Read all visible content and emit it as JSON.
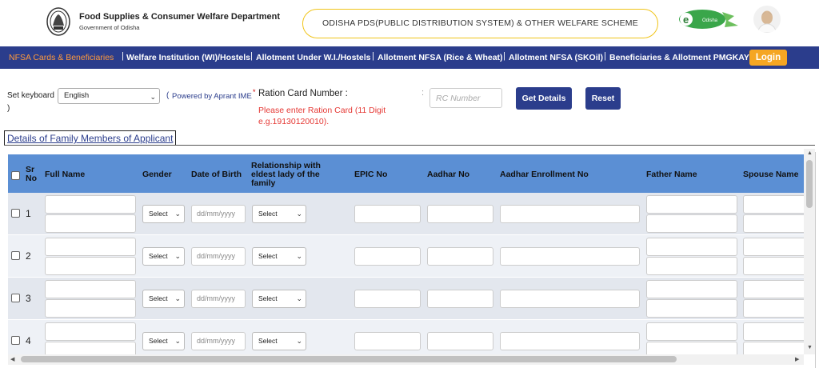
{
  "header": {
    "dept_title": "Food Supplies & Consumer Welfare Department",
    "dept_sub": "Government of Odisha",
    "banner": "ODISHA PDS(PUBLIC DISTRIBUTION SYSTEM) & OTHER WELFARE SCHEME",
    "logo_text": "Odisha",
    "logo_prefix": "e"
  },
  "nav": {
    "items": [
      "NFSA Cards & Beneficiaries",
      "Welfare Institution (WI)/Hostels",
      "Allotment Under W.I./Hostels",
      "Allotment NFSA (Rice & Wheat)",
      "Allotment NFSA (SKOil)",
      "Beneficiaries & Allotment PMGKAY"
    ],
    "separator": "|",
    "login": "Login"
  },
  "search": {
    "keyboard_label": "Set keyboard",
    "keyboard_value": "English",
    "powered_open": "(",
    "powered": "Powered by Aprant IME",
    "star": "*",
    "close_paren": ")",
    "rc_label": "Ration Card Number :",
    "rc_error": "Please enter Ration Card (11 Digit e.g.19130120010).",
    "rc_colon": ":",
    "rc_placeholder": "RC Number",
    "get_details": "Get Details",
    "reset": "Reset"
  },
  "section_title": "Details of Family Members of Applicant",
  "table": {
    "headers": {
      "sr": "Sr No",
      "full_name": "Full Name",
      "gender": "Gender",
      "dob": "Date of Birth",
      "relationship": "Relationship with eldest lady of the family",
      "epic": "EPIC No",
      "aadhar": "Aadhar No",
      "aadhar_enrollment": "Aadhar Enrollment No",
      "father": "Father Name",
      "spouse": "Spouse Name"
    },
    "select_label": "Select",
    "date_placeholder": "dd/mm/yyyy",
    "rows": [
      "1",
      "2",
      "3",
      "4"
    ]
  },
  "scroll": {
    "up": "▲",
    "down": "▼",
    "left": "◀",
    "right": "▶"
  }
}
